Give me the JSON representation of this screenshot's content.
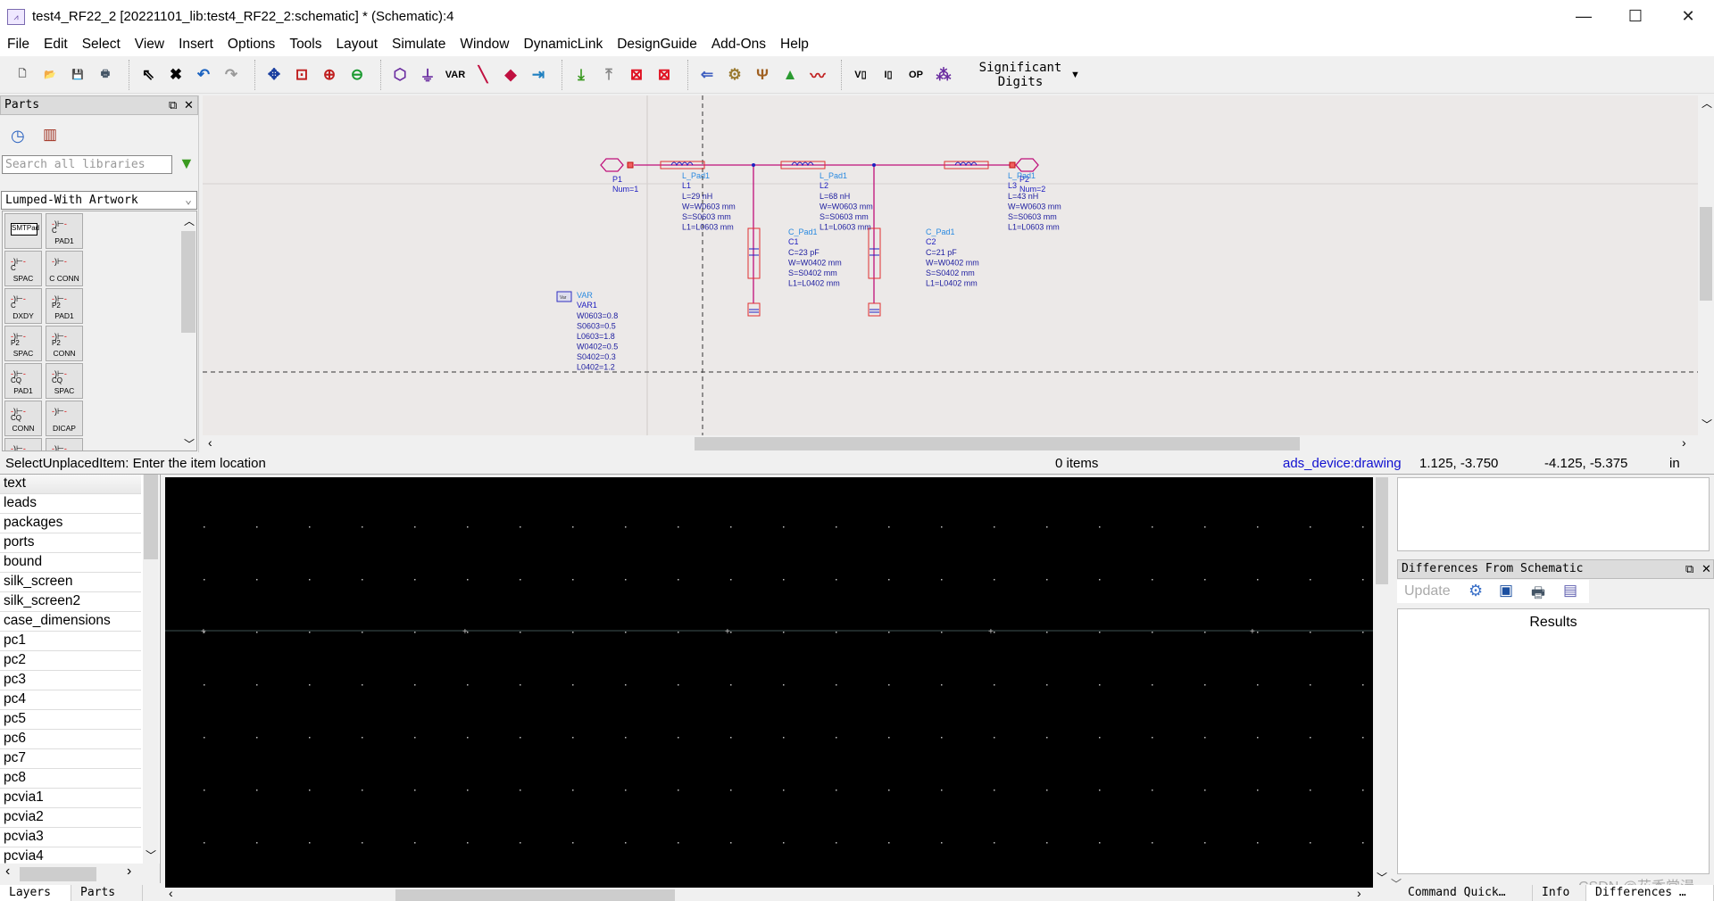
{
  "window": {
    "title": "test4_RF22_2 [20221101_lib:test4_RF22_2:schematic] * (Schematic):4",
    "app_icon": "ads-schematic-icon",
    "minimize": "—",
    "maximize": "☐",
    "close": "✕"
  },
  "menu": [
    "File",
    "Edit",
    "Select",
    "View",
    "Insert",
    "Options",
    "Tools",
    "Layout",
    "Simulate",
    "Window",
    "DynamicLink",
    "DesignGuide",
    "Add-Ons",
    "Help"
  ],
  "toolbar": {
    "groups": [
      [
        {
          "name": "new-icon",
          "g": "🗋",
          "c": "#555"
        },
        {
          "name": "open-icon",
          "g": "📂",
          "c": "#d9a040"
        },
        {
          "name": "save-icon",
          "g": "💾",
          "c": "#1b4fa0"
        },
        {
          "name": "print-icon",
          "g": "🖶",
          "c": "#456"
        }
      ],
      [
        {
          "name": "select-pointer-icon",
          "g": "⇖",
          "c": "#000"
        },
        {
          "name": "delete-icon",
          "g": "✖",
          "c": "#000"
        },
        {
          "name": "undo-icon",
          "g": "↶",
          "c": "#1a62c0"
        },
        {
          "name": "redo-icon",
          "g": "↷",
          "c": "#999"
        }
      ],
      [
        {
          "name": "pan-icon",
          "g": "✥",
          "c": "#1a3fa0"
        },
        {
          "name": "zoom-area-icon",
          "g": "⊡",
          "c": "#c02020"
        },
        {
          "name": "zoom-in-icon",
          "g": "⊕",
          "c": "#c02020"
        },
        {
          "name": "zoom-out-icon",
          "g": "⊖",
          "c": "#1a9a30"
        }
      ],
      [
        {
          "name": "port-icon",
          "g": "⬡",
          "c": "#6a2ca0"
        },
        {
          "name": "ground-icon",
          "g": "⏚",
          "c": "#6a2ca0"
        },
        {
          "name": "var-icon",
          "g": "VAR",
          "c": "#000"
        },
        {
          "name": "wire-icon",
          "g": "╲",
          "c": "#c01040"
        },
        {
          "name": "wire-label-icon",
          "g": "◆",
          "c": "#c01040"
        },
        {
          "name": "push-into-icon",
          "g": "⇥",
          "c": "#2080c0"
        }
      ],
      [
        {
          "name": "generate-layout-icon",
          "g": "⤓",
          "c": "#3a9a20"
        },
        {
          "name": "update-icon",
          "g": "⤒",
          "c": "#888"
        },
        {
          "name": "deactivate-icon",
          "g": "⊠",
          "c": "#e01020"
        },
        {
          "name": "short-icon",
          "g": "⊠",
          "c": "#e01020"
        }
      ],
      [
        {
          "name": "simulation-setup-icon",
          "g": "⇐",
          "c": "#4060c0"
        },
        {
          "name": "simulate-gear-icon",
          "g": "⚙",
          "c": "#9a7a30"
        },
        {
          "name": "tuning-icon",
          "g": "Ψ",
          "c": "#a06020"
        },
        {
          "name": "optimize-icon",
          "g": "▲",
          "c": "#2a9a30"
        },
        {
          "name": "data-display-icon",
          "g": "〰",
          "c": "#c02020"
        }
      ],
      [
        {
          "name": "voltage-annotate-icon",
          "g": "V▯",
          "c": "#000"
        },
        {
          "name": "current-annotate-icon",
          "g": "I▯",
          "c": "#000"
        },
        {
          "name": "op-annotate-icon",
          "g": "OP",
          "c": "#000"
        },
        {
          "name": "dc-annotate-icon",
          "g": "⁂",
          "c": "#6a2ca0"
        }
      ]
    ],
    "significant_digits": "Significant\nDigits"
  },
  "parts_panel": {
    "title": "Parts",
    "search_placeholder": "Search all libraries",
    "library": "Lumped-With Artwork",
    "items": [
      {
        "sym": "SMTPad",
        "label": ""
      },
      {
        "sym": "C",
        "label": "PAD1"
      },
      {
        "sym": "C",
        "label": "SPAC"
      },
      {
        "sym": "",
        "label": "C CONN"
      },
      {
        "sym": "C",
        "label": "DXDY"
      },
      {
        "sym": "P2",
        "label": "PAD1"
      },
      {
        "sym": "P2",
        "label": "SPAC"
      },
      {
        "sym": "P2",
        "label": "CONN"
      },
      {
        "sym": "CQ",
        "label": "PAD1"
      },
      {
        "sym": "CQ",
        "label": "SPAC"
      },
      {
        "sym": "CQ",
        "label": "CONN"
      },
      {
        "sym": "",
        "label": "DICAP"
      },
      {
        "sym": "",
        "label": ""
      },
      {
        "sym": "",
        "label": ""
      }
    ]
  },
  "schematic": {
    "ports": [
      {
        "name": "P1",
        "num": "Num=1"
      },
      {
        "name": "P2",
        "num": "Num=2"
      }
    ],
    "inductors": [
      {
        "type": "L_Pad1",
        "name": "L1",
        "params": [
          "L=29 nH",
          "W=W0603 mm",
          "S=S0603 mm",
          "L1=L0603 mm"
        ]
      },
      {
        "type": "L_Pad1",
        "name": "L2",
        "params": [
          "L=68 nH",
          "W=W0603 mm",
          "S=S0603 mm",
          "L1=L0603 mm"
        ]
      },
      {
        "type": "L_Pad1",
        "name": "L3",
        "params": [
          "L=43 nH",
          "W=W0603 mm",
          "S=S0603 mm",
          "L1=L0603 mm"
        ]
      }
    ],
    "capacitors": [
      {
        "type": "C_Pad1",
        "name": "C1",
        "params": [
          "C=23 pF",
          "W=W0402 mm",
          "S=S0402 mm",
          "L1=L0402 mm"
        ]
      },
      {
        "type": "C_Pad1",
        "name": "C2",
        "params": [
          "C=21 pF",
          "W=W0402 mm",
          "S=S0402 mm",
          "L1=L0402 mm"
        ]
      }
    ],
    "var": {
      "type": "VAR",
      "name": "VAR1",
      "icon_text": "Var Eqn",
      "params": [
        "W0603=0.8",
        "S0603=0.5",
        "L0603=1.8",
        "W0402=0.5",
        "S0402=0.3",
        "L0402=1.2"
      ]
    },
    "colors": {
      "wire": "#c0107a",
      "part": "#e03030",
      "symbol": "#2020c0",
      "type_label": "#2a8ae0",
      "param": "#2020a0"
    }
  },
  "status": {
    "message": "SelectUnplacedItem: Enter the item location",
    "items": "0 items",
    "context": "ads_device:drawing",
    "coord1": "1.125, -3.750",
    "coord2": "-4.125, -5.375",
    "units": "in"
  },
  "layers": [
    "text",
    "leads",
    "packages",
    "ports",
    "bound",
    "silk_screen",
    "silk_screen2",
    "case_dimensions",
    "pc1",
    "pc2",
    "pc3",
    "pc4",
    "pc5",
    "pc6",
    "pc7",
    "pc8",
    "pcvia1",
    "pcvia2",
    "pcvia3",
    "pcvia4"
  ],
  "differences_panel": {
    "title": "Differences From Schematic",
    "update": "Update",
    "results": "Results"
  },
  "bottom_tabs_left": [
    "Layers",
    "Parts"
  ],
  "bottom_tabs_right": [
    "Command Quick…",
    "Info",
    "Differences …"
  ],
  "watermark": "CSDN @花香常漫"
}
